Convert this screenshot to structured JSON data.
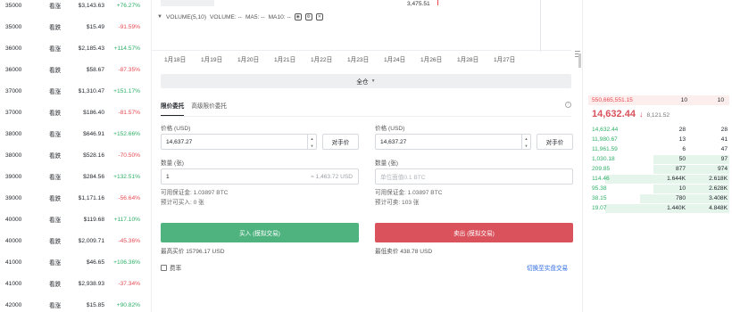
{
  "options": [
    {
      "strike": "35000",
      "type": "看涨",
      "price": "$3,143.63",
      "change": "+76.27%",
      "dir": "up"
    },
    {
      "strike": "35000",
      "type": "看跌",
      "price": "$15.49",
      "change": "-91.59%",
      "dir": "down"
    },
    {
      "strike": "36000",
      "type": "看涨",
      "price": "$2,185.43",
      "change": "+114.57%",
      "dir": "up"
    },
    {
      "strike": "36000",
      "type": "看跌",
      "price": "$58.67",
      "change": "-87.35%",
      "dir": "down"
    },
    {
      "strike": "37000",
      "type": "看涨",
      "price": "$1,310.47",
      "change": "+151.17%",
      "dir": "up"
    },
    {
      "strike": "37000",
      "type": "看跌",
      "price": "$186.40",
      "change": "-81.57%",
      "dir": "down"
    },
    {
      "strike": "38000",
      "type": "看涨",
      "price": "$646.91",
      "change": "+152.66%",
      "dir": "up"
    },
    {
      "strike": "38000",
      "type": "看跌",
      "price": "$528.16",
      "change": "-70.50%",
      "dir": "down"
    },
    {
      "strike": "39000",
      "type": "看涨",
      "price": "$284.56",
      "change": "+132.51%",
      "dir": "up"
    },
    {
      "strike": "39000",
      "type": "看跌",
      "price": "$1,171.16",
      "change": "-56.64%",
      "dir": "down"
    },
    {
      "strike": "40000",
      "type": "看涨",
      "price": "$119.68",
      "change": "+117.10%",
      "dir": "up"
    },
    {
      "strike": "40000",
      "type": "看跌",
      "price": "$2,009.71",
      "change": "-45.36%",
      "dir": "down"
    },
    {
      "strike": "41000",
      "type": "看涨",
      "price": "$46.65",
      "change": "+106.36%",
      "dir": "up"
    },
    {
      "strike": "41000",
      "type": "看跌",
      "price": "$2,938.93",
      "change": "-37.34%",
      "dir": "down"
    },
    {
      "strike": "42000",
      "type": "看涨",
      "price": "$15.85",
      "change": "+90.82%",
      "dir": "up"
    }
  ],
  "chart": {
    "top_price": "3,475.51",
    "volume_label": "VOLUME(5,10)",
    "volume_val": "VOLUME: --",
    "ma5": "MA5: --",
    "ma10": "MA10: --",
    "dates": [
      "1月18日",
      "1月19日",
      "1月20日",
      "1月21日",
      "1月22日",
      "1月23日",
      "1月24日",
      "1月26日",
      "1月28日",
      "1月27日"
    ]
  },
  "order": {
    "margin_mode": "全仓",
    "tabs": [
      "限价委托",
      "高级限价委托"
    ],
    "price_label": "价格 (USD)",
    "qty_label": "数量 (张)",
    "counter_btn": "对手价",
    "buy": {
      "price": "14,637.27",
      "qty": "1",
      "qty_hint": "≈ 1,463.72 USD",
      "available": "可用保证金: 1.03897 BTC",
      "estimate": "预计可买入: 0 张",
      "button": "买入 (模拟交易)",
      "limit": "最高买价 15796.17 USD"
    },
    "sell": {
      "price": "14,637.27",
      "qty_placeholder": "单位面值0.1 BTC",
      "available": "可用保证金: 1.03897 BTC",
      "estimate": "预计可卖: 103 张",
      "button": "卖出 (模拟交易)",
      "limit": "最低卖价 438.78 USD"
    },
    "fee": "费率",
    "switch_link": "切换至实盘交易"
  },
  "book": {
    "ask": {
      "price": "550,665,551.15",
      "size": "10",
      "total": "10"
    },
    "last": "14,632.44",
    "mark": "8,121.52",
    "bids": [
      {
        "price": "14,632.44",
        "size": "28",
        "total": "28",
        "depth": 0
      },
      {
        "price": "11,980.67",
        "size": "13",
        "total": "41",
        "depth": 0
      },
      {
        "price": "11,961.59",
        "size": "6",
        "total": "47",
        "depth": 0
      },
      {
        "price": "1,030.18",
        "size": "50",
        "total": "97",
        "depth": 0.55
      },
      {
        "price": "209.85",
        "size": "877",
        "total": "974",
        "depth": 0.55
      },
      {
        "price": "114.46",
        "size": "1.644K",
        "total": "2.618K",
        "depth": 0.9
      },
      {
        "price": "95.38",
        "size": "10",
        "total": "2.628K",
        "depth": 0.55
      },
      {
        "price": "38.15",
        "size": "780",
        "total": "3.408K",
        "depth": 0.65
      },
      {
        "price": "19.07",
        "size": "1.440K",
        "total": "4.848K",
        "depth": 0.9
      }
    ]
  }
}
